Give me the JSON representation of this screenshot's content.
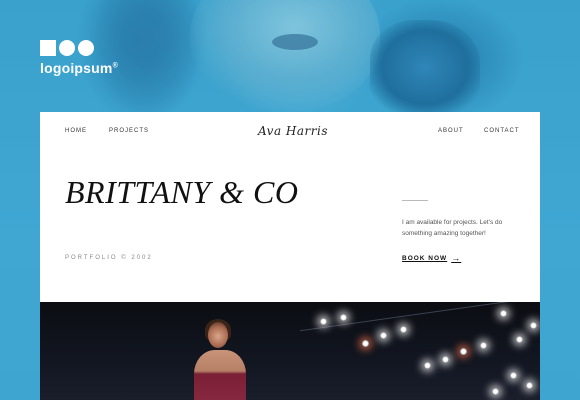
{
  "logo": {
    "text": "logoipsum",
    "mark": "®"
  },
  "nav": {
    "home": "HOME",
    "projects": "PROJECTS",
    "signature": "Ava Harris",
    "about": "ABOUT",
    "contact": "CONTACT"
  },
  "hero": {
    "title": "BRITTANY & CO",
    "portfolio": "PORTFOLIO © 2002",
    "availability": "I am available for projects. Let's do something amazing together!",
    "cta": "BOOK NOW",
    "cta_icon": "arrow-right-icon"
  },
  "colors": {
    "background": "#3ea3cf",
    "card": "#ffffff",
    "text": "#111111"
  }
}
